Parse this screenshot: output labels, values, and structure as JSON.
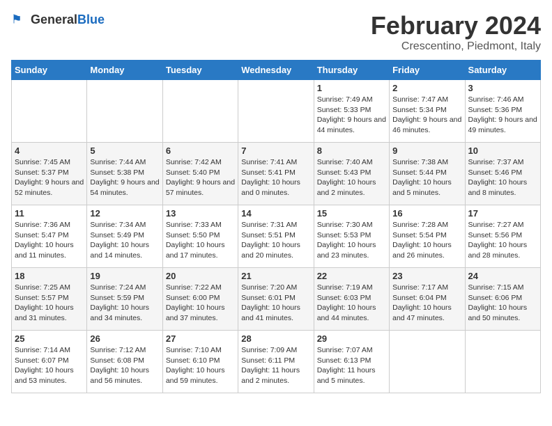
{
  "header": {
    "logo_general": "General",
    "logo_blue": "Blue",
    "month_year": "February 2024",
    "location": "Crescentino, Piedmont, Italy"
  },
  "days_of_week": [
    "Sunday",
    "Monday",
    "Tuesday",
    "Wednesday",
    "Thursday",
    "Friday",
    "Saturday"
  ],
  "weeks": [
    [
      {
        "day": "",
        "info": ""
      },
      {
        "day": "",
        "info": ""
      },
      {
        "day": "",
        "info": ""
      },
      {
        "day": "",
        "info": ""
      },
      {
        "day": "1",
        "info": "Sunrise: 7:49 AM\nSunset: 5:33 PM\nDaylight: 9 hours and 44 minutes."
      },
      {
        "day": "2",
        "info": "Sunrise: 7:47 AM\nSunset: 5:34 PM\nDaylight: 9 hours and 46 minutes."
      },
      {
        "day": "3",
        "info": "Sunrise: 7:46 AM\nSunset: 5:36 PM\nDaylight: 9 hours and 49 minutes."
      }
    ],
    [
      {
        "day": "4",
        "info": "Sunrise: 7:45 AM\nSunset: 5:37 PM\nDaylight: 9 hours and 52 minutes."
      },
      {
        "day": "5",
        "info": "Sunrise: 7:44 AM\nSunset: 5:38 PM\nDaylight: 9 hours and 54 minutes."
      },
      {
        "day": "6",
        "info": "Sunrise: 7:42 AM\nSunset: 5:40 PM\nDaylight: 9 hours and 57 minutes."
      },
      {
        "day": "7",
        "info": "Sunrise: 7:41 AM\nSunset: 5:41 PM\nDaylight: 10 hours and 0 minutes."
      },
      {
        "day": "8",
        "info": "Sunrise: 7:40 AM\nSunset: 5:43 PM\nDaylight: 10 hours and 2 minutes."
      },
      {
        "day": "9",
        "info": "Sunrise: 7:38 AM\nSunset: 5:44 PM\nDaylight: 10 hours and 5 minutes."
      },
      {
        "day": "10",
        "info": "Sunrise: 7:37 AM\nSunset: 5:46 PM\nDaylight: 10 hours and 8 minutes."
      }
    ],
    [
      {
        "day": "11",
        "info": "Sunrise: 7:36 AM\nSunset: 5:47 PM\nDaylight: 10 hours and 11 minutes."
      },
      {
        "day": "12",
        "info": "Sunrise: 7:34 AM\nSunset: 5:49 PM\nDaylight: 10 hours and 14 minutes."
      },
      {
        "day": "13",
        "info": "Sunrise: 7:33 AM\nSunset: 5:50 PM\nDaylight: 10 hours and 17 minutes."
      },
      {
        "day": "14",
        "info": "Sunrise: 7:31 AM\nSunset: 5:51 PM\nDaylight: 10 hours and 20 minutes."
      },
      {
        "day": "15",
        "info": "Sunrise: 7:30 AM\nSunset: 5:53 PM\nDaylight: 10 hours and 23 minutes."
      },
      {
        "day": "16",
        "info": "Sunrise: 7:28 AM\nSunset: 5:54 PM\nDaylight: 10 hours and 26 minutes."
      },
      {
        "day": "17",
        "info": "Sunrise: 7:27 AM\nSunset: 5:56 PM\nDaylight: 10 hours and 28 minutes."
      }
    ],
    [
      {
        "day": "18",
        "info": "Sunrise: 7:25 AM\nSunset: 5:57 PM\nDaylight: 10 hours and 31 minutes."
      },
      {
        "day": "19",
        "info": "Sunrise: 7:24 AM\nSunset: 5:59 PM\nDaylight: 10 hours and 34 minutes."
      },
      {
        "day": "20",
        "info": "Sunrise: 7:22 AM\nSunset: 6:00 PM\nDaylight: 10 hours and 37 minutes."
      },
      {
        "day": "21",
        "info": "Sunrise: 7:20 AM\nSunset: 6:01 PM\nDaylight: 10 hours and 41 minutes."
      },
      {
        "day": "22",
        "info": "Sunrise: 7:19 AM\nSunset: 6:03 PM\nDaylight: 10 hours and 44 minutes."
      },
      {
        "day": "23",
        "info": "Sunrise: 7:17 AM\nSunset: 6:04 PM\nDaylight: 10 hours and 47 minutes."
      },
      {
        "day": "24",
        "info": "Sunrise: 7:15 AM\nSunset: 6:06 PM\nDaylight: 10 hours and 50 minutes."
      }
    ],
    [
      {
        "day": "25",
        "info": "Sunrise: 7:14 AM\nSunset: 6:07 PM\nDaylight: 10 hours and 53 minutes."
      },
      {
        "day": "26",
        "info": "Sunrise: 7:12 AM\nSunset: 6:08 PM\nDaylight: 10 hours and 56 minutes."
      },
      {
        "day": "27",
        "info": "Sunrise: 7:10 AM\nSunset: 6:10 PM\nDaylight: 10 hours and 59 minutes."
      },
      {
        "day": "28",
        "info": "Sunrise: 7:09 AM\nSunset: 6:11 PM\nDaylight: 11 hours and 2 minutes."
      },
      {
        "day": "29",
        "info": "Sunrise: 7:07 AM\nSunset: 6:13 PM\nDaylight: 11 hours and 5 minutes."
      },
      {
        "day": "",
        "info": ""
      },
      {
        "day": "",
        "info": ""
      }
    ]
  ]
}
